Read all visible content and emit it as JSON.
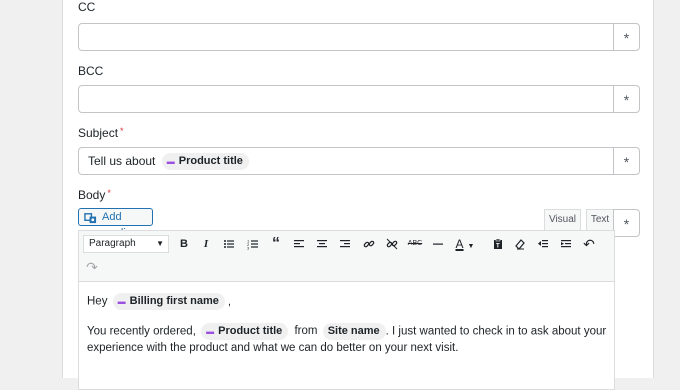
{
  "fields": {
    "cc": {
      "label": "CC",
      "value": ""
    },
    "bcc": {
      "label": "BCC",
      "value": ""
    },
    "subject": {
      "label": "Subject",
      "required_mark": "*",
      "prefix": "Tell us about",
      "tag": "Product title"
    },
    "merge_tag_button_icon": "asterisk-icon"
  },
  "body": {
    "label": "Body",
    "required_mark": "*",
    "add_media_label": "Add media",
    "tabs": {
      "visual": "Visual",
      "text": "Text",
      "active": "visual"
    },
    "format_select": "Paragraph",
    "toolbar_icons": [
      "bold-icon",
      "italic-icon",
      "bullet-list-icon",
      "numbered-list-icon",
      "blockquote-icon",
      "align-left-icon",
      "align-center-icon",
      "align-right-icon",
      "link-icon",
      "unlink-icon",
      "strikethrough-icon",
      "horizontal-line-icon",
      "text-color-icon",
      "paste-text-icon",
      "clear-formatting-icon",
      "outdent-icon",
      "indent-icon",
      "undo-icon",
      "redo-icon"
    ],
    "content": {
      "greeting": "Hey",
      "greeting_tag": "Billing first name",
      "greeting_end": ",",
      "line2_start": "You recently ordered,",
      "line2_tag1": "Product title",
      "line2_mid": "from",
      "line2_tag2": "Site name",
      "line2_rest": ". I just wanted to check in to ask about your experience with the product and what we can do better on your next visit."
    }
  },
  "colors": {
    "accent": "#2271b1",
    "required": "#d63638",
    "tag_icon": "#9b51e0"
  }
}
